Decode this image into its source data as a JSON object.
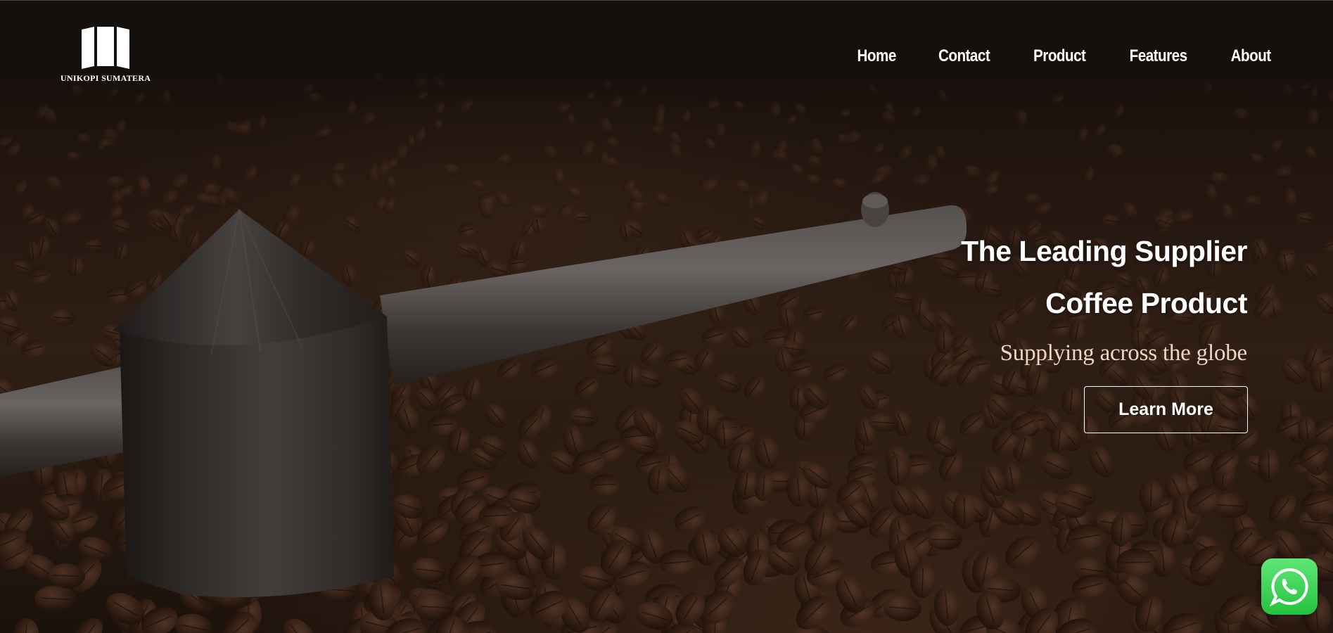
{
  "brand": {
    "name": "UNIKOPI SUMATERA",
    "logo_icon": "book-logo-icon"
  },
  "nav": {
    "items": [
      {
        "label": "Home"
      },
      {
        "label": "Contact"
      },
      {
        "label": "Product"
      },
      {
        "label": "Features"
      },
      {
        "label": "About"
      }
    ]
  },
  "hero": {
    "headline_line1": "The Leading Supplier",
    "headline_line2": "Coffee Product",
    "tagline": "Supplying across the globe",
    "cta_label": "Learn More",
    "background": "coffee-beans-roaster-photo"
  },
  "floating": {
    "whatsapp_icon": "whatsapp-icon"
  },
  "colors": {
    "tagline": "#eed5c6",
    "whatsapp": "#25c13d",
    "text": "#ffffff"
  }
}
